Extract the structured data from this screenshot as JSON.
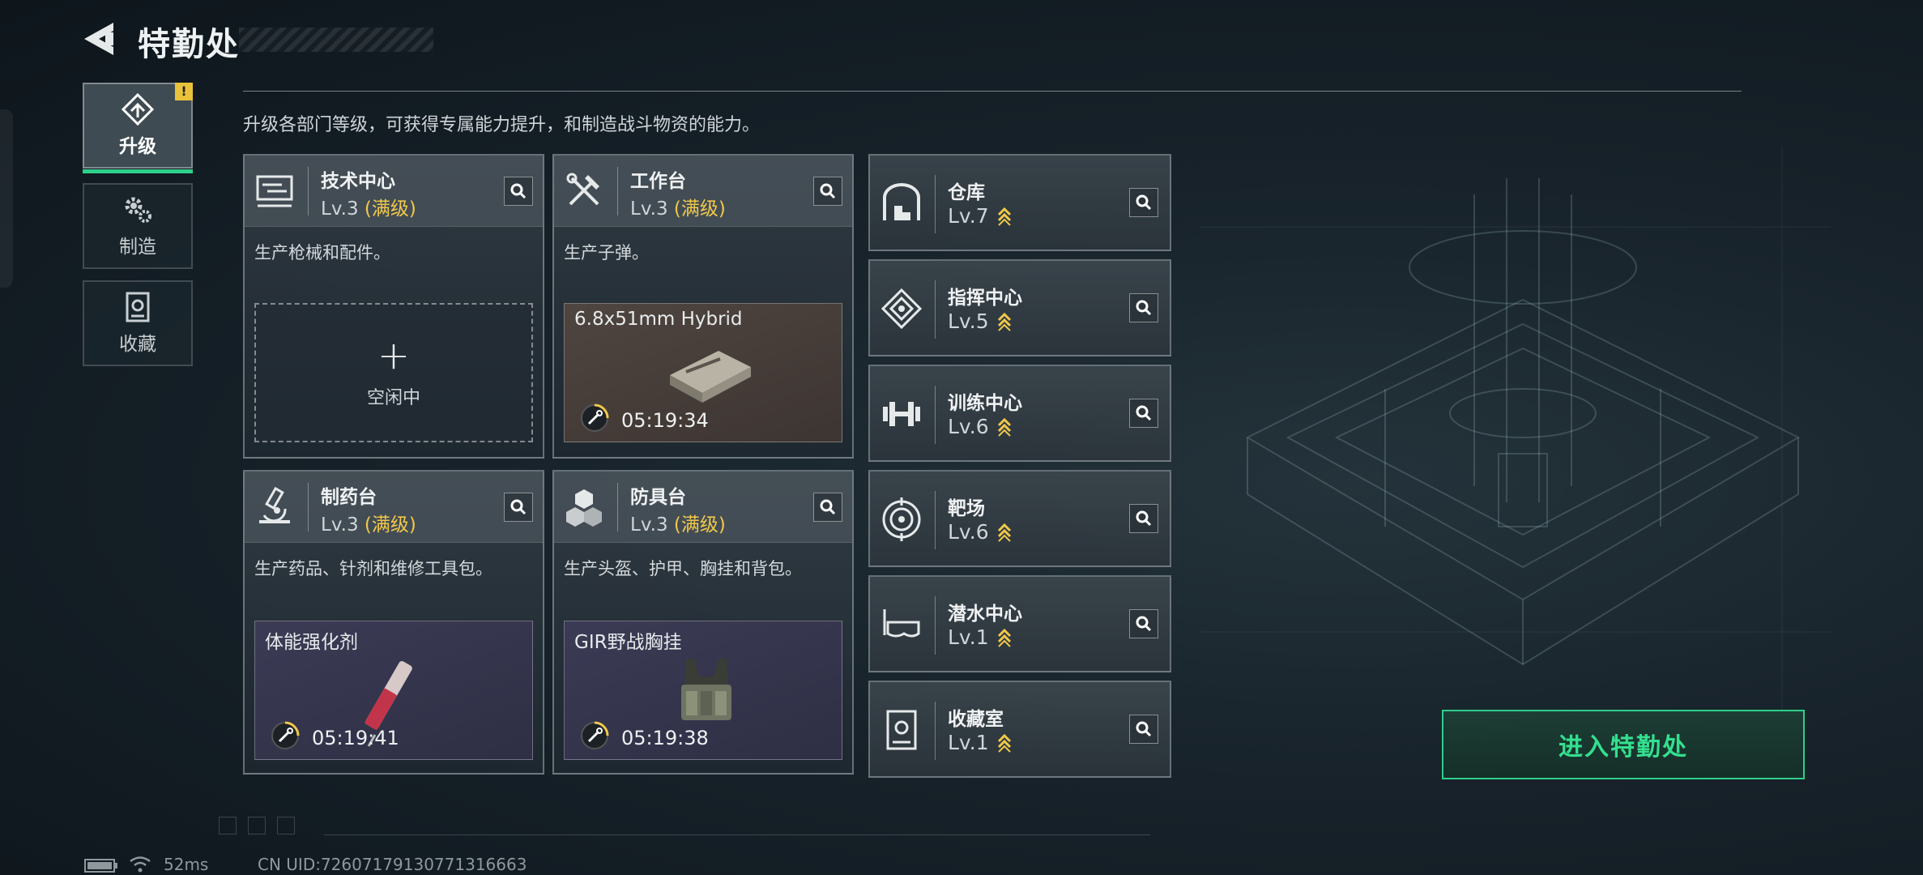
{
  "header": {
    "title": "特勤处"
  },
  "nav": [
    {
      "label": "升级",
      "icon": "upgrade-icon",
      "active": true,
      "badge": "!"
    },
    {
      "label": "制造",
      "icon": "gear-icon",
      "active": false
    },
    {
      "label": "收藏",
      "icon": "collection-icon",
      "active": false
    }
  ],
  "main": {
    "description": "升级各部门等级，可获得专属能力提升，和制造战斗物资的能力。",
    "workshops": [
      {
        "name": "技术中心",
        "level": "Lv.3",
        "max_label": "(满级)",
        "desc": "生产枪械和配件。",
        "icon": "monitor-icon",
        "slot": {
          "state": "empty",
          "label": "空闲中"
        }
      },
      {
        "name": "工作台",
        "level": "Lv.3",
        "max_label": "(满级)",
        "desc": "生产子弹。",
        "icon": "tools-icon",
        "slot": {
          "state": "crafting",
          "item": "6.8x51mm Hybrid",
          "timer": "05:19:34"
        }
      },
      {
        "name": "制药台",
        "level": "Lv.3",
        "max_label": "(满级)",
        "desc": "生产药品、针剂和维修工具包。",
        "icon": "microscope-icon",
        "slot": {
          "state": "crafting",
          "item": "体能强化剂",
          "timer": "05:19:41"
        }
      },
      {
        "name": "防具台",
        "level": "Lv.3",
        "max_label": "(满级)",
        "desc": "生产头盔、护甲、胸挂和背包。",
        "icon": "cubes-icon",
        "slot": {
          "state": "crafting",
          "item": "GIR野战胸挂",
          "timer": "05:19:38"
        }
      }
    ],
    "facilities": [
      {
        "name": "仓库",
        "level": "Lv.7",
        "icon": "warehouse-icon"
      },
      {
        "name": "指挥中心",
        "level": "Lv.5",
        "icon": "command-icon"
      },
      {
        "name": "训练中心",
        "level": "Lv.6",
        "icon": "dumbbell-icon"
      },
      {
        "name": "靶场",
        "level": "Lv.6",
        "icon": "target-icon"
      },
      {
        "name": "潜水中心",
        "level": "Lv.1",
        "icon": "diving-mask-icon"
      },
      {
        "name": "收藏室",
        "level": "Lv.1",
        "icon": "collection-room-icon"
      }
    ],
    "enter_button": "进入特勤处"
  },
  "status_bar": {
    "ping": "52ms",
    "uid": "CN UID:72607179130771316663"
  },
  "colors": {
    "accent_green": "#2ecf8a",
    "max_yellow": "#f1c84a",
    "badge_yellow": "#e9c23b"
  }
}
